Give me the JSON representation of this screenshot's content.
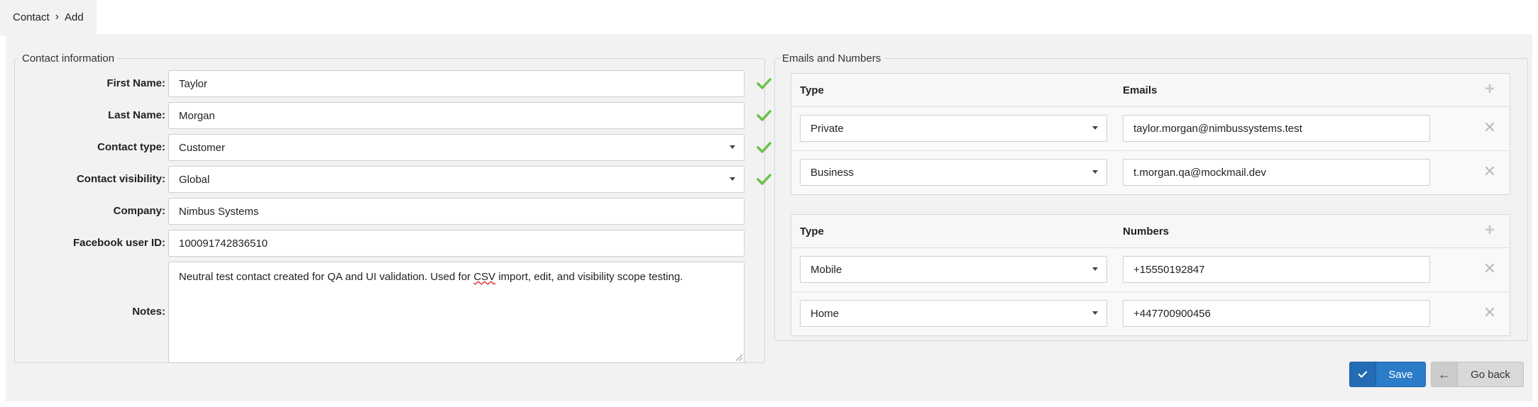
{
  "breadcrumb": {
    "parent": "Contact",
    "current": "Add"
  },
  "contact": {
    "legend": "Contact information",
    "first_name": {
      "label": "First Name:",
      "value": "Taylor"
    },
    "last_name": {
      "label": "Last Name:",
      "value": "Morgan"
    },
    "contact_type": {
      "label": "Contact type:",
      "value": "Customer"
    },
    "visibility": {
      "label": "Contact visibility:",
      "value": "Global"
    },
    "company": {
      "label": "Company:",
      "value": "Nimbus Systems"
    },
    "facebook": {
      "label": "Facebook user ID:",
      "value": "100091742836510"
    },
    "notes": {
      "label": "Notes:",
      "value_before": "Neutral test contact created for QA and UI validation. Used for ",
      "value_flagged": "CSV",
      "value_after": " import, edit, and visibility scope testing."
    }
  },
  "emails_numbers": {
    "legend": "Emails and Numbers",
    "emails_table": {
      "type_header": "Type",
      "value_header": "Emails",
      "rows": [
        {
          "type": "Private",
          "value": "taylor.morgan@nimbussystems.test"
        },
        {
          "type": "Business",
          "value": "t.morgan.qa@mockmail.dev"
        }
      ]
    },
    "numbers_table": {
      "type_header": "Type",
      "value_header": "Numbers",
      "rows": [
        {
          "type": "Mobile",
          "value": "+15550192847"
        },
        {
          "type": "Home",
          "value": "+447700900456"
        }
      ]
    }
  },
  "actions": {
    "save_label": "Save",
    "back_label": "Go back"
  },
  "colors": {
    "accent": "#2b7cc9",
    "valid": "#6cc24a",
    "background": "#f2f2f2"
  },
  "icons": {
    "valid": "check-icon",
    "add": "plus-icon",
    "remove": "close-icon",
    "save": "check-icon",
    "back": "arrow-left-icon"
  }
}
